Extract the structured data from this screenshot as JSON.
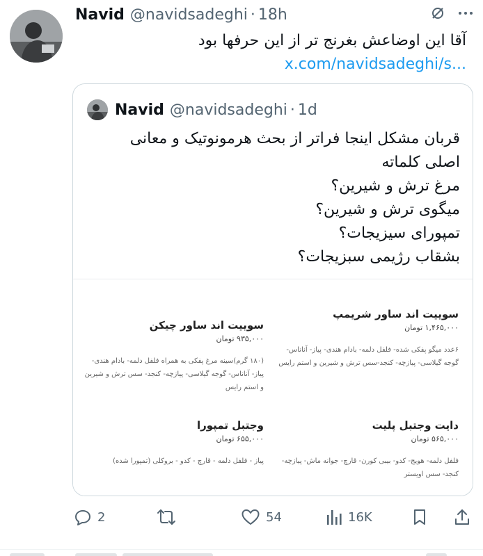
{
  "tweet": {
    "author_name": "Navid",
    "author_handle": "@navidsadeghi",
    "separator": "·",
    "time": "18h",
    "text": "آقا این اوضاعش بغرنج تر از این حرفها بود",
    "link": "x.com/navidsadeghi/s..."
  },
  "quote": {
    "author_name": "Navid",
    "author_handle": "@navidsadeghi",
    "separator": "·",
    "time": "1d",
    "lines": [
      "قربان مشکل اینجا فراتر از بحث هرمونوتیک و معانی",
      "اصلی کلماته",
      "مرغ ترش و شیرین؟",
      "میگوی ترش و شیرین؟",
      "تمپورای سیزیجات؟",
      "بشقاب رژیمی سبزیجات؟"
    ],
    "menu": [
      {
        "title": "سوییت اند ساور شریمپ",
        "price": "۱,۴۶۵,۰۰۰ تومان",
        "desc": "۶عدد میگو پفکی شده- فلفل دلمه- بادام هندی- پیاز- آناناس- گوجه گیلاسی- پیازچه- کنجد-سس ترش و شیرین و استم رایس"
      },
      {
        "title": "سوییت اند ساور چیکن",
        "price": "۹۳۵,۰۰۰ تومان",
        "desc": "(۱۸۰ گرم)سینه مرغ پفکی به همراه فلفل دلمه- بادام هندی- پیاز- آناناس- گوجه گیلاسی- پیازچه- کنجد- سس ترش و شیرین و استم رایس"
      },
      {
        "title": "دایت وجتبل پلیت",
        "price": "۵۶۵,۰۰۰ تومان",
        "desc": "فلفل دلمه- هویج- کدو- بیبی کورن- قارچ- جوانه ماش- پیازچه- کنجد- سس اویستر"
      },
      {
        "title": "وجتبل تمپورا",
        "price": "۶۵۵,۰۰۰ تومان",
        "desc": "پیاز - فلفل دلمه - قارچ - کدو - بروکلی (تمپورا شده)"
      }
    ]
  },
  "actions": {
    "replies": "2",
    "likes": "54",
    "views": "16K"
  },
  "icons": [
    "no-eye-icon",
    "more-icon",
    "reply-icon",
    "retweet-icon",
    "like-icon",
    "views-icon",
    "bookmark-icon",
    "share-icon"
  ],
  "colors": {
    "text": "#0f1419",
    "muted": "#536471",
    "link": "#1d9bf0",
    "border": "#cfd9de"
  }
}
